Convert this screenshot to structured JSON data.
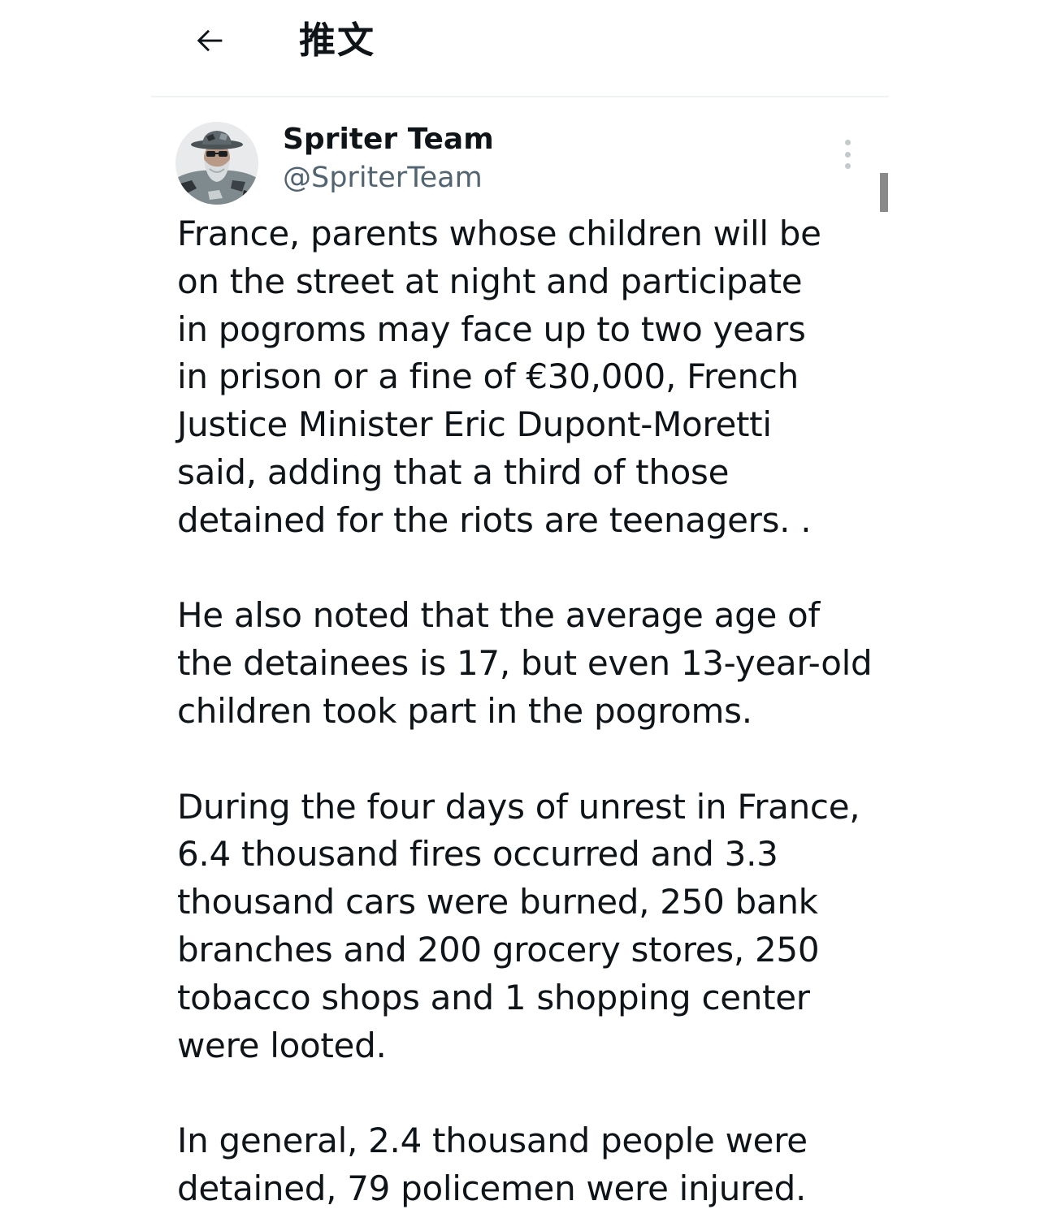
{
  "header": {
    "back_icon": "arrow-left-icon",
    "title": "推文"
  },
  "tweet": {
    "author": {
      "name": "Spriter Team",
      "handle": "@SpriterTeam",
      "avatar_icon": "avatar-photo"
    },
    "more_icon": "vertical-ellipsis-icon",
    "paragraphs": [
      [
        "France, parents whose children will be",
        "on the street at night and participate",
        "in pogroms may face up to two years",
        "in prison or a fine of €30,000, French",
        "Justice Minister Eric Dupont-Moretti",
        "said, adding that a third of those",
        "detained for the riots are teenagers. ."
      ],
      [
        "He also noted that the average age of",
        "the detainees is 17, but even 13-year-old",
        "children took part in the pogroms."
      ],
      [
        "During the four days of unrest in France,",
        "6.4 thousand fires occurred and 3.3",
        "thousand cars were burned, 250 bank",
        "branches and 200 grocery stores, 250",
        "tobacco shops and 1 shopping center",
        "were looted."
      ],
      [
        "In general, 2.4 thousand people were",
        "detained, 79 policemen were injured."
      ]
    ]
  },
  "colors": {
    "text": "#0f1419",
    "secondary": "#536471",
    "divider": "#eff3f4"
  }
}
